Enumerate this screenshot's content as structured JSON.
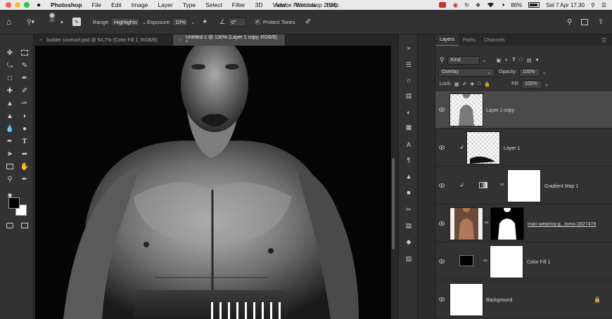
{
  "menubar": {
    "app": "Photoshop",
    "items": [
      "File",
      "Edit",
      "Image",
      "Layer",
      "Type",
      "Select",
      "Filter",
      "3D",
      "View",
      "Window",
      "Help"
    ],
    "window_title": "Adobe Photoshop 2020",
    "battery": "86%",
    "datetime": "Sel 7 Apr  17.30"
  },
  "options": {
    "brush_size": "30",
    "range_label": "Range:",
    "range_value": "Highlights",
    "exposure_label": "Exposure:",
    "exposure_value": "10%",
    "angle_value": "0°",
    "protect_tones": "Protect Tones"
  },
  "tabs": [
    {
      "label": "builder coverart.psd @ 54,7% (Color Fill 1, RGB/8)",
      "active": false
    },
    {
      "label": "Untitled-1 @ 130% (Layer 1 copy, RGB/8) *",
      "active": true
    }
  ],
  "layers_panel": {
    "tabs": [
      "Layers",
      "Paths",
      "Channels"
    ],
    "filter_kind": "Kind",
    "blend_mode": "Overlay",
    "opacity_label": "Opacity:",
    "opacity_value": "100%",
    "lock_label": "Lock:",
    "fill_label": "Fill:",
    "fill_value": "100%",
    "layers": [
      {
        "name": "Layer 1 copy",
        "selected": true
      },
      {
        "name": "Layer 1",
        "selected": false
      },
      {
        "name": "Gradient Map 1",
        "selected": false
      },
      {
        "name": "man-wearing-g...toms-2827479",
        "selected": false
      },
      {
        "name": "Color Fill 1",
        "selected": false
      },
      {
        "name": "Background",
        "selected": false
      }
    ]
  },
  "colors": {
    "accent": "#3a78d8",
    "panel_bg": "#323232",
    "selected_layer": "#4a4a4a"
  }
}
